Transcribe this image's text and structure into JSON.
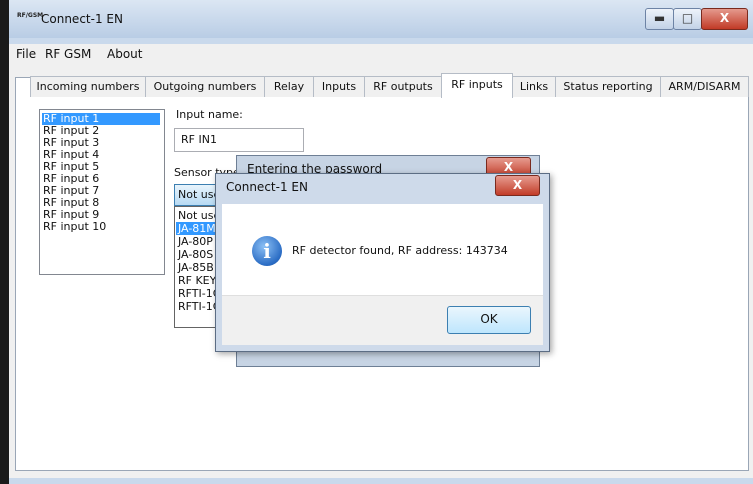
{
  "window": {
    "icon_text": "RF/GSM",
    "title": "Connect-1 EN",
    "min_glyph": "▬",
    "max_glyph": "□",
    "close_glyph": "X"
  },
  "menu": [
    "File",
    "RF GSM",
    "About"
  ],
  "tabs": [
    "Incoming numbers",
    "Outgoing numbers",
    "Relay",
    "Inputs",
    "RF outputs",
    "RF inputs",
    "Links",
    "Status reporting",
    "ARM/DISARM"
  ],
  "active_tab": "RF inputs",
  "rf_inputs": [
    "RF input 1",
    "RF input 2",
    "RF input 3",
    "RF input 4",
    "RF input 5",
    "RF input 6",
    "RF input 7",
    "RF input 8",
    "RF input 9",
    "RF input 10"
  ],
  "form": {
    "input_name_label": "Input name:",
    "input_name_value": "RF IN1",
    "sensor_type_label": "Sensor type",
    "sensor_selected": "Not use",
    "sensor_options": [
      "Not use",
      "JA-81M",
      "JA-80P",
      "JA-80S",
      "JA-85B",
      "RF KEY",
      "RFTI-1C",
      "RFTI-1C"
    ]
  },
  "password_dialog": {
    "title": "Entering the password",
    "close_glyph": "X"
  },
  "message_dialog": {
    "title": "Connect-1 EN",
    "close_glyph": "X",
    "icon": "i",
    "text": "RF detector found, RF address: 143734",
    "ok": "OK"
  }
}
